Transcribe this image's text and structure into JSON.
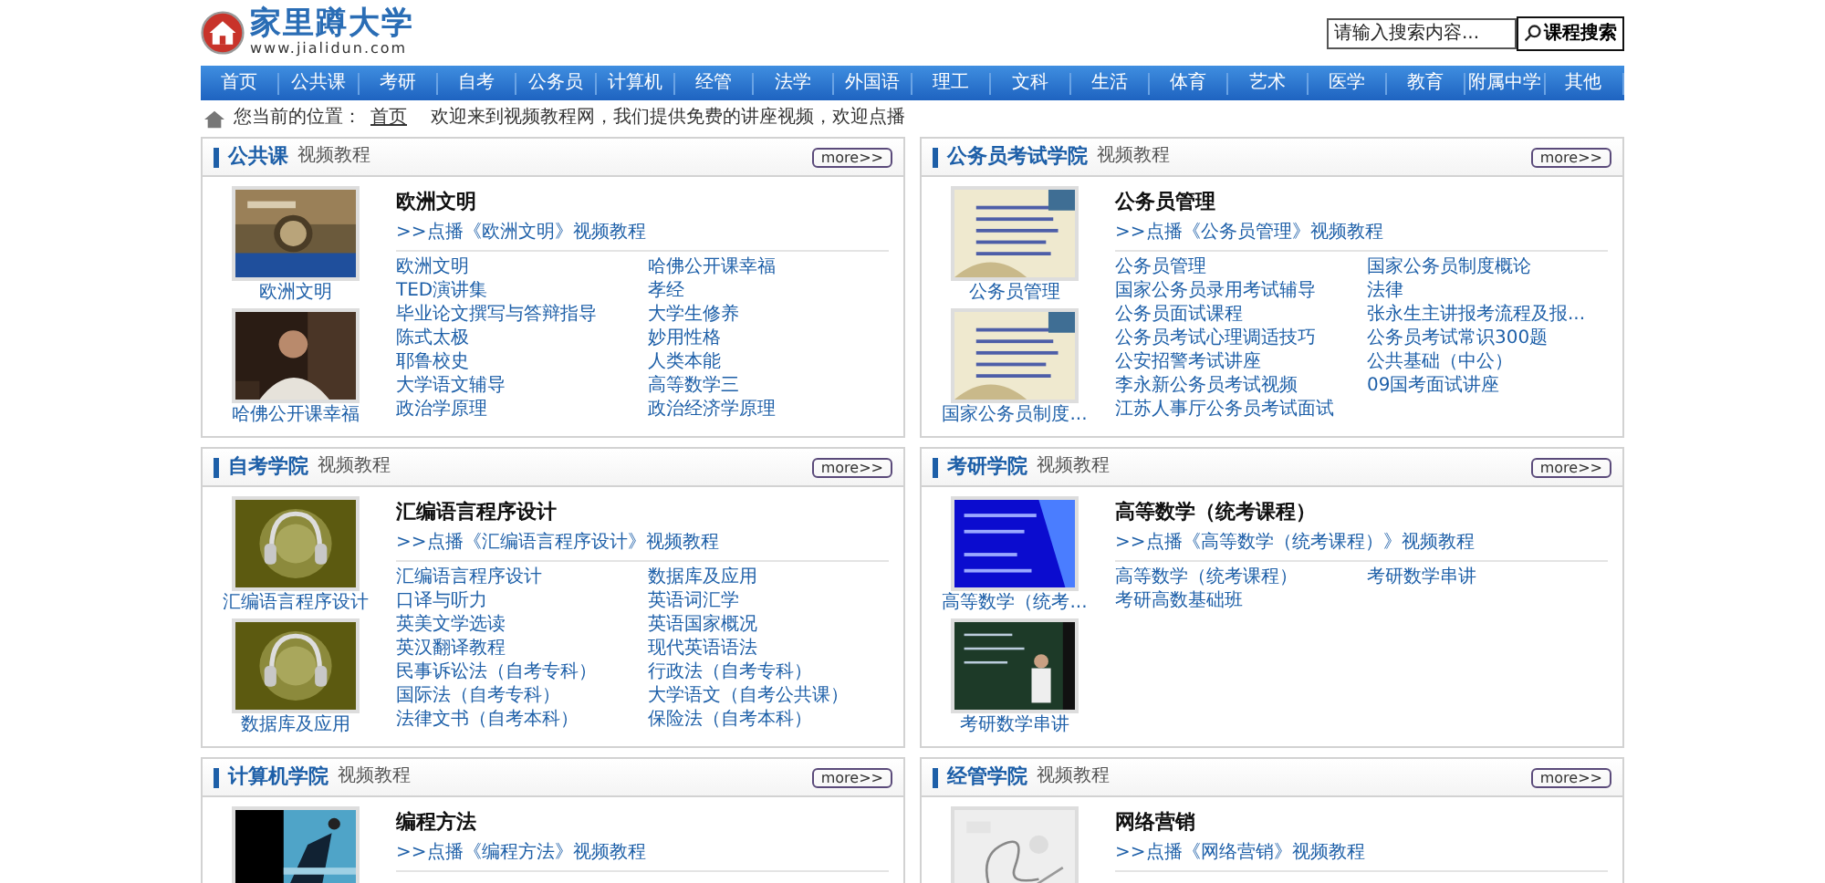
{
  "logo": {
    "name": "家里蹲大学",
    "url": "www.jialidun.com"
  },
  "search": {
    "placeholder": "请输入搜索内容...",
    "button": "课程搜索"
  },
  "nav": [
    "首页",
    "公共课",
    "考研",
    "自考",
    "公务员",
    "计算机",
    "经管",
    "法学",
    "外国语",
    "理工",
    "文科",
    "生活",
    "体育",
    "艺术",
    "医学",
    "教育",
    "附属中学",
    "其他"
  ],
  "breadcrumb": {
    "label": "您当前的位置：",
    "home": "首页",
    "message": "欢迎来到视频教程网，我们提供免费的讲座视频，欢迎点播"
  },
  "panels": [
    {
      "title": "公共课",
      "subtitle": "视频教程",
      "more": "more>>",
      "thumbs": [
        {
          "kind": "picture",
          "caption": "欧洲文明"
        },
        {
          "kind": "picture",
          "caption": "哈佛公开课幸福"
        }
      ],
      "course": "欧洲文明",
      "play_link": ">>点播《欧洲文明》视频教程",
      "links": [
        "欧洲文明",
        "哈佛公开课幸福",
        "TED演讲集",
        "孝经",
        "毕业论文撰写与答辩指导",
        "大学生修养",
        "陈式太极",
        "妙用性格",
        "耶鲁校史",
        "人类本能",
        "大学语文辅导",
        "高等数学三",
        "政治学原理",
        "政治经济学原理"
      ]
    },
    {
      "title": "公务员考试学院",
      "subtitle": "视频教程",
      "more": "more>>",
      "thumbs": [
        {
          "kind": "picture",
          "caption": "公务员管理"
        },
        {
          "kind": "picture",
          "caption": "国家公务员制度..."
        }
      ],
      "course": "公务员管理",
      "play_link": ">>点播《公务员管理》视频教程",
      "links": [
        "公务员管理",
        "国家公务员制度概论",
        "国家公务员录用考试辅导",
        "法律",
        "公务员面试课程",
        "张永生主讲报考流程及报...",
        "公务员考试心理调适技巧",
        "公务员考试常识300题",
        "公安招警考试讲座",
        "公共基础（中公）",
        "李永新公务员考试视频",
        "09国考面试讲座",
        "江苏人事厅公务员考试面试"
      ]
    },
    {
      "title": "自考学院",
      "subtitle": "视频教程",
      "more": "more>>",
      "thumbs": [
        {
          "kind": "picture",
          "caption": "汇编语言程序设计"
        },
        {
          "kind": "picture",
          "caption": "数据库及应用"
        }
      ],
      "course": "汇编语言程序设计",
      "play_link": ">>点播《汇编语言程序设计》视频教程",
      "links": [
        "汇编语言程序设计",
        "数据库及应用",
        "口译与听力",
        "英语词汇学",
        "英美文学选读",
        "英语国家概况",
        "英汉翻译教程",
        "现代英语语法",
        "民事诉讼法（自考专科）",
        "行政法（自考专科）",
        "国际法（自考专科）",
        "大学语文（自考公共课）",
        "法律文书（自考本科）",
        "保险法（自考本科）"
      ]
    },
    {
      "title": "考研学院",
      "subtitle": "视频教程",
      "more": "more>>",
      "thumbs": [
        {
          "kind": "picture",
          "caption": "高等数学（统考..."
        },
        {
          "kind": "picture",
          "caption": "考研数学串讲"
        }
      ],
      "course": "高等数学（统考课程）",
      "play_link": ">>点播《高等数学（统考课程）》视频教程",
      "links": [
        "高等数学（统考课程）",
        "考研数学串讲",
        "考研高数基础班"
      ]
    },
    {
      "title": "计算机学院",
      "subtitle": "视频教程",
      "more": "more>>",
      "course": "编程方法",
      "play_link": ">>点播《编程方法》视频教程"
    },
    {
      "title": "经管学院",
      "subtitle": "视频教程",
      "more": "more>>",
      "course": "网络营销",
      "play_link": ">>点播《网络营销》视频教程"
    }
  ]
}
